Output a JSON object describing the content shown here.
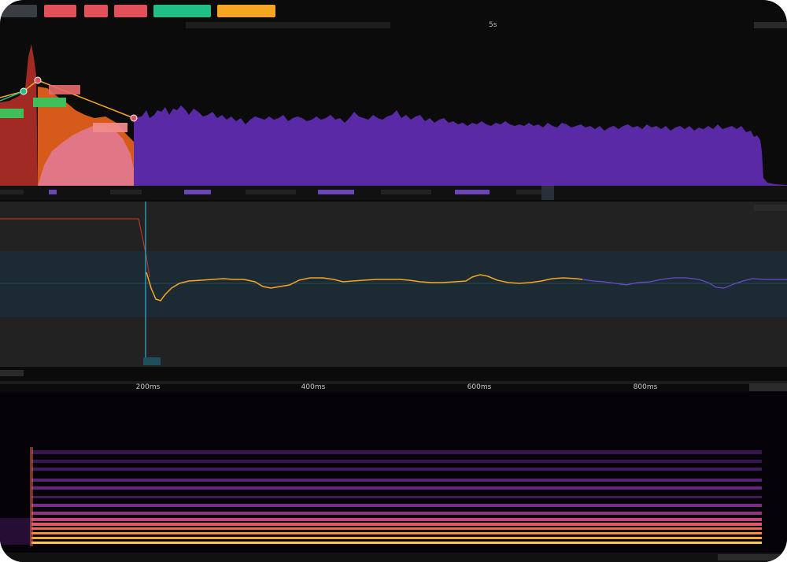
{
  "header": {
    "tabs": [
      {
        "id": "tab-0",
        "color": "#3a3e44"
      },
      {
        "id": "tab-1",
        "color": "#e2505a"
      },
      {
        "id": "tab-2",
        "color": "#e2505a"
      },
      {
        "id": "tab-3",
        "color": "#e2505a"
      },
      {
        "id": "tab-4",
        "color": "#1fbf86"
      },
      {
        "id": "tab-5",
        "color": "#f5a623"
      }
    ],
    "time_marker": "5s"
  },
  "time_axis": {
    "labels": [
      "200ms",
      "400ms",
      "600ms",
      "800ms"
    ]
  },
  "colors": {
    "waveform": "#5a2aa6",
    "region_red": "#a12a25",
    "region_orange": "#d65a19",
    "region_pink": "#e1788d",
    "pitch_line": "#f5a623",
    "pitch_tail": "#6a4bd0",
    "cursor": "#2a9fb8",
    "pitch_band": "#1b2a33"
  }
}
